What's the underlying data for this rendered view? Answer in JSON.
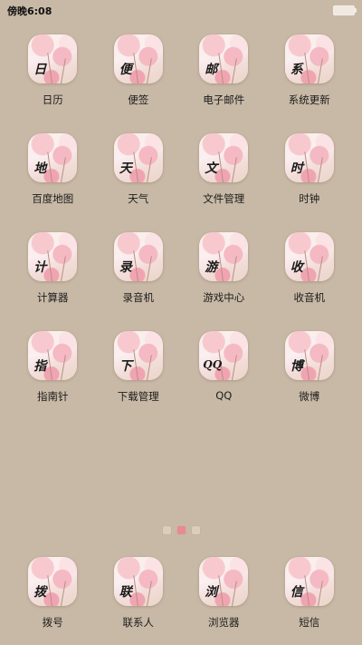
{
  "status_bar": {
    "time": "傍晚6:08"
  },
  "apps": [
    {
      "label": "日历",
      "glyph": "日"
    },
    {
      "label": "便签",
      "glyph": "便"
    },
    {
      "label": "电子邮件",
      "glyph": "邮"
    },
    {
      "label": "系统更新",
      "glyph": "系"
    },
    {
      "label": "百度地图",
      "glyph": "地"
    },
    {
      "label": "天气",
      "glyph": "天"
    },
    {
      "label": "文件管理",
      "glyph": "文"
    },
    {
      "label": "时钟",
      "glyph": "时"
    },
    {
      "label": "计算器",
      "glyph": "计"
    },
    {
      "label": "录音机",
      "glyph": "录"
    },
    {
      "label": "游戏中心",
      "glyph": "游"
    },
    {
      "label": "收音机",
      "glyph": "收"
    },
    {
      "label": "指南针",
      "glyph": "指"
    },
    {
      "label": "下载管理",
      "glyph": "下"
    },
    {
      "label": "QQ",
      "glyph": "QQ"
    },
    {
      "label": "微博",
      "glyph": "博"
    }
  ],
  "page_indicator": {
    "total": 3,
    "active": 2
  },
  "dock": [
    {
      "label": "拨号",
      "glyph": "拨"
    },
    {
      "label": "联系人",
      "glyph": "联"
    },
    {
      "label": "浏览器",
      "glyph": "浏"
    },
    {
      "label": "短信",
      "glyph": "信"
    }
  ]
}
